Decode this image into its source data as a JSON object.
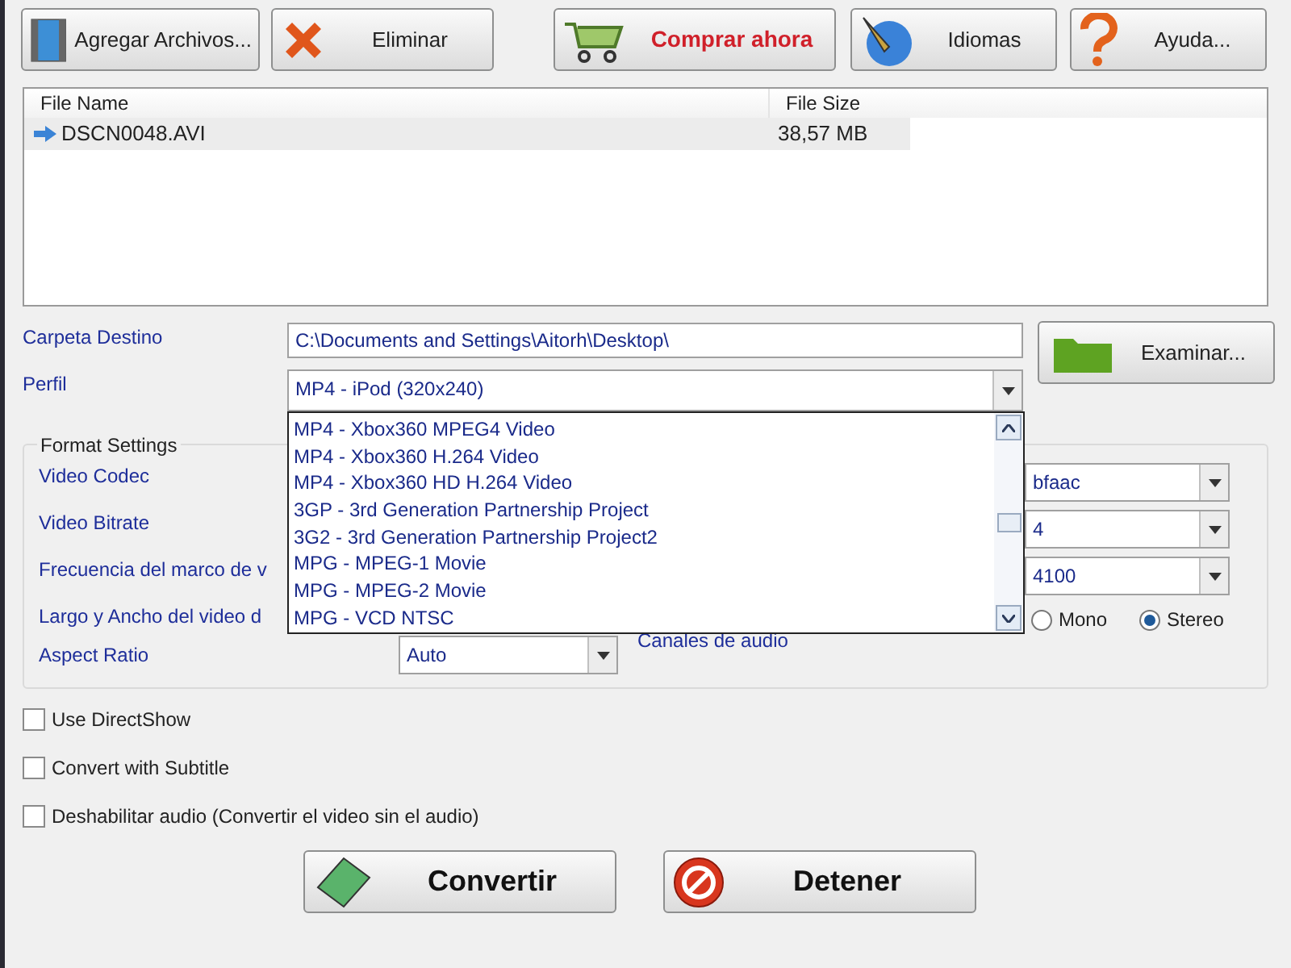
{
  "toolbar": [
    {
      "label": "Agregar Archivos...",
      "kind": "add"
    },
    {
      "label": "Eliminar",
      "kind": "delete"
    },
    {
      "label": "Comprar ahora",
      "kind": "buy"
    },
    {
      "label": "Idiomas",
      "kind": "language"
    },
    {
      "label": "Ayuda...",
      "kind": "help"
    }
  ],
  "file_table": {
    "columns": [
      "File Name",
      "File Size"
    ],
    "rows": [
      {
        "name": "DSCN0048.AVI",
        "size": "38,57 MB",
        "selected": true
      }
    ]
  },
  "destination": {
    "label": "Carpeta Destino",
    "value": "C:\\Documents and Settings\\Aitorh\\Desktop\\",
    "browse_button": "Examinar..."
  },
  "profile": {
    "label": "Perfil",
    "value": "MP4 - iPod (320x240)",
    "expanded": true,
    "options": [
      "MP4 - Xbox360 MPEG4 Video",
      "MP4 - Xbox360 H.264 Video",
      "MP4 - Xbox360 HD H.264 Video",
      "3GP - 3rd Generation Partnership Project",
      "3G2 - 3rd Generation Partnership Project2",
      "MPG - MPEG-1 Movie",
      "MPG - MPEG-2 Movie",
      "MPG - VCD NTSC"
    ]
  },
  "format_settings": {
    "title": "Format Settings",
    "labels": [
      "Video Codec",
      "Video Bitrate",
      "Frecuencia del marco de v",
      "Largo y Ancho del video d"
    ],
    "audio_combos": [
      "bfaac",
      "4",
      "4100"
    ],
    "channels_label": "Canales de audio",
    "channels": [
      {
        "label": "Mono",
        "selected": false
      },
      {
        "label": "Stereo",
        "selected": true
      }
    ],
    "aspect_ratio": {
      "label": "Aspect Ratio",
      "value": "Auto"
    }
  },
  "options": [
    {
      "label": "Use DirectShow",
      "checked": false
    },
    {
      "label": "Convert with Subtitle",
      "checked": false
    },
    {
      "label": "Deshabilitar audio (Convertir el video sin el audio)",
      "checked": false
    }
  ],
  "actions": [
    {
      "label": "Convertir",
      "kind": "convert"
    },
    {
      "label": "Detener",
      "kind": "stop"
    }
  ]
}
